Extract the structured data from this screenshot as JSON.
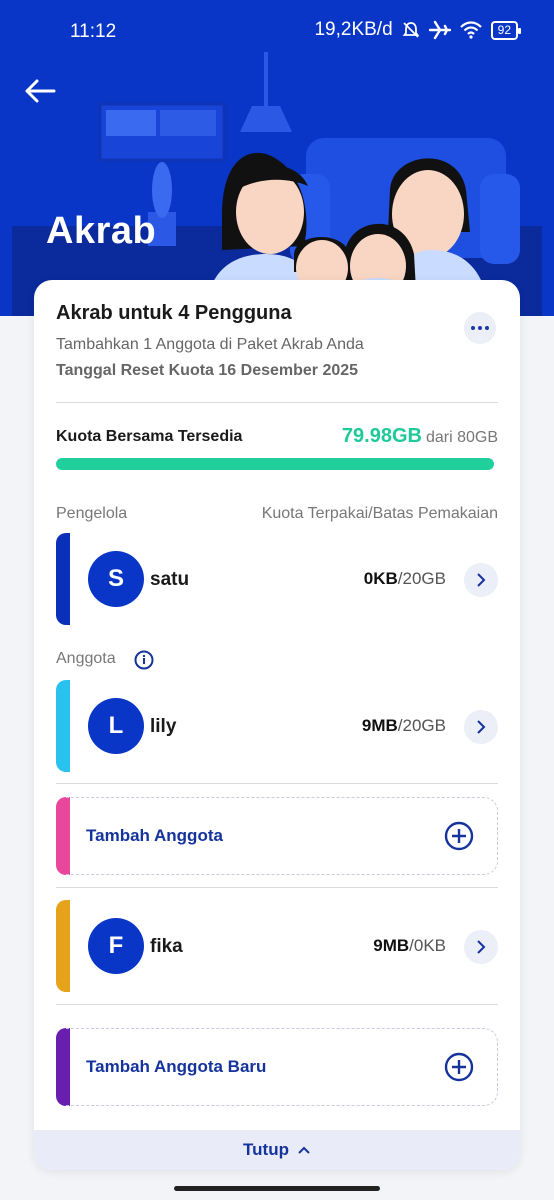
{
  "status_bar": {
    "time": "11:12",
    "network": "19,2KB/d",
    "battery": "92"
  },
  "header": {
    "title": "Akrab"
  },
  "package": {
    "title": "Akrab untuk 4 Pengguna",
    "subtitle": "Tambahkan 1 Anggota di Paket Akrab Anda",
    "reset_text": "Tanggal Reset Kuota 16 Desember 2025"
  },
  "quota": {
    "label": "Kuota Bersama Tersedia",
    "available": "79.98GB",
    "total_text": "dari 80GB",
    "fraction": 0.99975
  },
  "manager_section": {
    "label": "Pengelola",
    "usage_header": "Kuota Terpakai/Batas Pemakaian"
  },
  "manager": {
    "initial": "S",
    "name": "satu",
    "used": "0KB",
    "limit": "/20GB",
    "color": "#0a2fb8"
  },
  "members_section": {
    "label": "Anggota"
  },
  "members": [
    {
      "initial": "L",
      "name": "lily",
      "used": "9MB",
      "limit": "/20GB",
      "color": "#29c2ee"
    },
    {
      "initial": "F",
      "name": "fika",
      "used": "9MB",
      "limit": "/0KB",
      "color": "#e6a21a"
    }
  ],
  "add_slots": [
    {
      "label": "Tambah Anggota",
      "color": "#e9479b"
    },
    {
      "label": "Tambah Anggota Baru",
      "color": "#6a1eb0"
    }
  ],
  "footer": {
    "close_label": "Tutup"
  },
  "colors": {
    "brand": "#0a36c7",
    "accent": "#20cf9c",
    "link": "#15339c"
  }
}
